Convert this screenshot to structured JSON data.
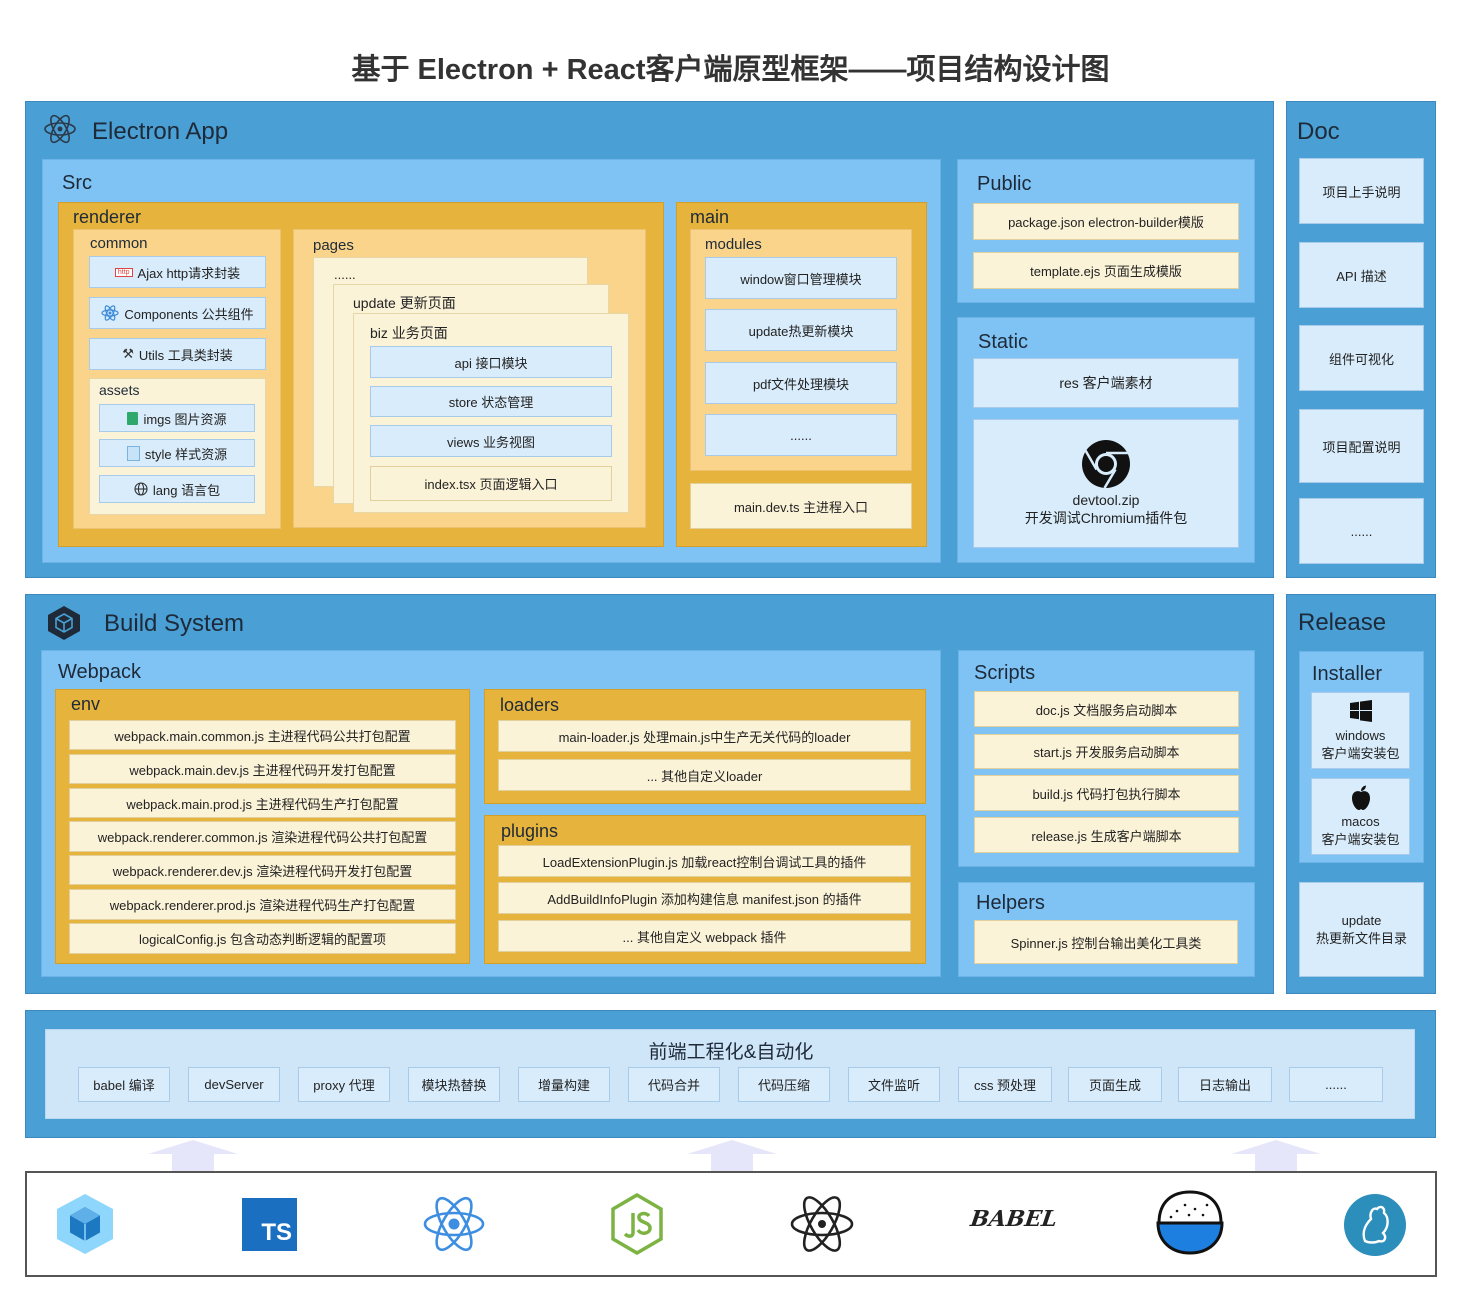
{
  "title": "基于 Electron + React客户端原型框架——项目结构设计图",
  "electron_app": {
    "title": "Electron App",
    "src": {
      "title": "Src",
      "renderer": {
        "title": "renderer",
        "common": {
          "title": "common",
          "ajax": "Ajax http请求封装",
          "ajax_icon_text": "http",
          "components": "Components 公共组件",
          "utils": "Utils 工具类封装",
          "assets": {
            "title": "assets",
            "imgs": "imgs 图片资源",
            "style": "style 样式资源",
            "lang": "lang 语言包"
          }
        },
        "pages": {
          "title": "pages",
          "dots": "......",
          "update": "update 更新页面",
          "biz": {
            "title": "biz 业务页面",
            "api": "api 接口模块",
            "store": "store 状态管理",
            "views": "views 业务视图",
            "index": "index.tsx 页面逻辑入口"
          }
        }
      },
      "main": {
        "title": "main",
        "modules": {
          "title": "modules",
          "items": [
            "window窗口管理模块",
            "update热更新模块",
            "pdf文件处理模块",
            "......"
          ]
        },
        "entry": "main.dev.ts 主进程入口"
      }
    },
    "public": {
      "title": "Public",
      "items": [
        "package.json electron-builder模版",
        "template.ejs 页面生成模版"
      ]
    },
    "static": {
      "title": "Static",
      "res": "res 客户端素材",
      "devtool_name": "devtool.zip",
      "devtool_desc": "开发调试Chromium插件包"
    }
  },
  "doc": {
    "title": "Doc",
    "items": [
      "项目上手说明",
      "API 描述",
      "组件可视化",
      "项目配置说明",
      "......"
    ]
  },
  "build_system": {
    "title": "Build System",
    "webpack": {
      "title": "Webpack",
      "env": {
        "title": "env",
        "items": [
          "webpack.main.common.js 主进程代码公共打包配置",
          "webpack.main.dev.js 主进程代码开发打包配置",
          "webpack.main.prod.js 主进程代码生产打包配置",
          "webpack.renderer.common.js 渲染进程代码公共打包配置",
          "webpack.renderer.dev.js 渲染进程代码开发打包配置",
          "webpack.renderer.prod.js 渲染进程代码生产打包配置",
          "logicalConfig.js 包含动态判断逻辑的配置项"
        ]
      },
      "loaders": {
        "title": "loaders",
        "items": [
          "main-loader.js 处理main.js中生产无关代码的loader",
          "... 其他自定义loader"
        ]
      },
      "plugins": {
        "title": "plugins",
        "items": [
          "LoadExtensionPlugin.js 加载react控制台调试工具的插件",
          "AddBuildInfoPlugin 添加构建信息 manifest.json 的插件",
          "... 其他自定义 webpack 插件"
        ]
      }
    },
    "scripts": {
      "title": "Scripts",
      "items": [
        "doc.js 文档服务启动脚本",
        "start.js 开发服务启动脚本",
        "build.js 代码打包执行脚本",
        "release.js 生成客户端脚本"
      ]
    },
    "helpers": {
      "title": "Helpers",
      "items": [
        "Spinner.js 控制台输出美化工具类"
      ]
    }
  },
  "release": {
    "title": "Release",
    "installer": {
      "title": "Installer",
      "windows_name": "windows",
      "windows_desc": "客户端安装包",
      "macos_name": "macos",
      "macos_desc": "客户端安装包"
    },
    "update_name": "update",
    "update_desc": "热更新文件目录"
  },
  "automation": {
    "title": "前端工程化&自动化",
    "items": [
      "babel 编译",
      "devServer",
      "proxy 代理",
      "模块热替换",
      "增量构建",
      "代码合并",
      "代码压缩",
      "文件监听",
      "css 预处理",
      "页面生成",
      "日志输出",
      "......"
    ]
  },
  "tech_logos": {
    "webpack": "webpack-logo-icon",
    "ts_text": "TS",
    "react": "react-logo-icon",
    "node": "nodejs-logo-icon",
    "electron": "electron-logo-icon",
    "babel_text": "BABEL",
    "yarn": "rice-bowl-logo-icon",
    "last": "blue-circle-logo-icon"
  },
  "colors": {
    "dark_blue": "#4a9fd5",
    "light_blue": "#7fc3f5",
    "orange": "#e6b33c",
    "pale_orange": "#f9d48a",
    "cream": "#fbf3d8",
    "item_blue": "#d9ecfb"
  }
}
